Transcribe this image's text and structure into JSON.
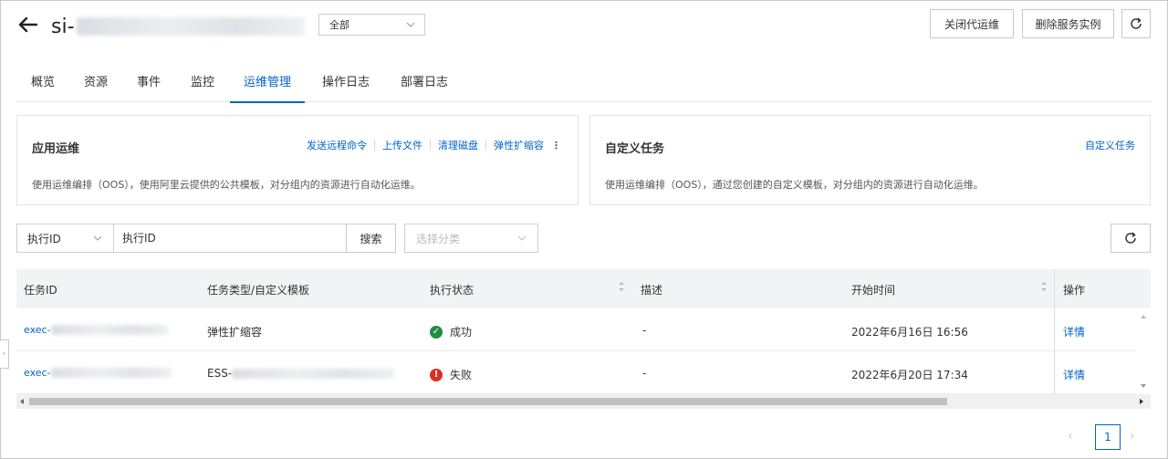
{
  "header": {
    "title_prefix": "si-",
    "scope_value": "全部",
    "close_ops_label": "关闭代运维",
    "delete_instance_label": "删除服务实例"
  },
  "tabs": [
    {
      "label": "概览"
    },
    {
      "label": "资源"
    },
    {
      "label": "事件"
    },
    {
      "label": "监控"
    },
    {
      "label": "运维管理",
      "active": true
    },
    {
      "label": "操作日志"
    },
    {
      "label": "部署日志"
    }
  ],
  "app_ops_card": {
    "title": "应用运维",
    "links": [
      "发送远程命令",
      "上传文件",
      "清理磁盘",
      "弹性扩缩容"
    ],
    "description": "使用运维编排（OOS），使用阿里云提供的公共模板，对分组内的资源进行自动化运维。"
  },
  "custom_task_card": {
    "title": "自定义任务",
    "link": "自定义任务",
    "description": "使用运维编排（OOS），通过您创建的自定义模板，对分组内的资源进行自动化运维。"
  },
  "filter": {
    "type_value": "执行ID",
    "input_placeholder": "执行ID",
    "search_label": "搜索",
    "category_placeholder": "选择分类"
  },
  "table": {
    "columns": [
      "任务ID",
      "任务类型/自定义模板",
      "执行状态",
      "描述",
      "开始时间",
      "操作"
    ],
    "rows": [
      {
        "task_id_prefix": "exec-",
        "task_type": "弹性扩缩容",
        "status": "成功",
        "status_kind": "success",
        "description": "-",
        "start_time": "2022年6月16日 16:56",
        "action": "详情"
      },
      {
        "task_id_prefix": "exec-",
        "task_type": "ESS-",
        "status": "失败",
        "status_kind": "failed",
        "description": "-",
        "start_time": "2022年6月20日 17:34",
        "action": "详情"
      }
    ]
  },
  "pagination": {
    "current_page": "1"
  },
  "colors": {
    "accent": "#0064c8",
    "success": "#1e8e3e",
    "failed": "#d93026"
  }
}
